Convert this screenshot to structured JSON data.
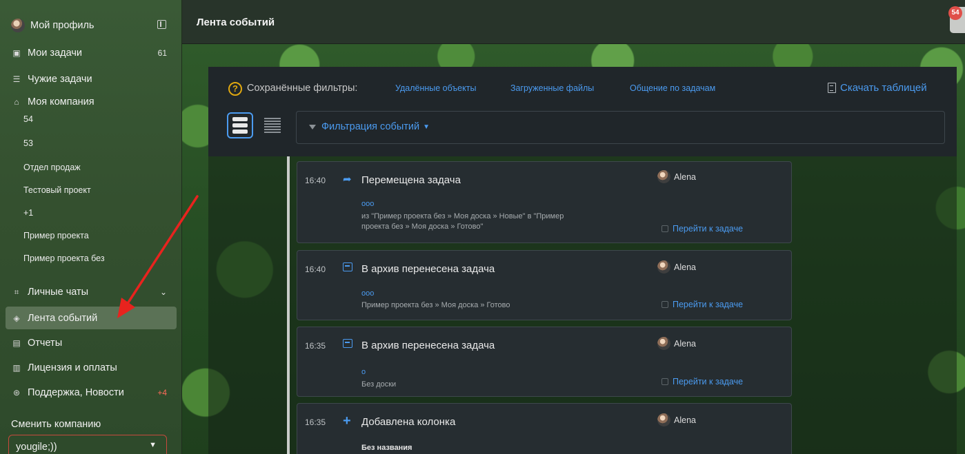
{
  "sidebar": {
    "profile": {
      "label": "Мой профиль",
      "icon": "avatar"
    },
    "items": [
      {
        "label": "Мои задачи",
        "icon": "tasks-icon",
        "count": "61"
      },
      {
        "label": "Чужие задачи",
        "icon": "list-icon",
        "count": ""
      },
      {
        "label": "Моя компания",
        "icon": "company-icon",
        "count": ""
      }
    ],
    "projects": [
      "54",
      "53",
      "Отдел продаж",
      "Тестовый проект",
      "+1",
      "Пример проекта",
      "Пример проекта без"
    ],
    "personal_chats": {
      "label": "Личные чаты",
      "icon": "chat-icon"
    },
    "events_feed": {
      "label": "Лента событий",
      "icon": "feed-icon"
    },
    "reports": {
      "label": "Отчеты",
      "icon": "reports-icon"
    },
    "license": {
      "label": "Лицензия и оплаты",
      "icon": "license-icon"
    },
    "support": {
      "label": "Поддержка, Новости",
      "icon": "support-icon",
      "count": "+4"
    },
    "switch_company_label": "Сменить компанию",
    "company_value": "yougile;))"
  },
  "header": {
    "title": "Лента событий",
    "notification_count": "54"
  },
  "filters": {
    "saved_label": "Сохранённые фильтры:",
    "links": [
      "Удалённые объекты",
      "Загруженные файлы",
      "Общение по задачам"
    ],
    "download_label": "Скачать таблицей",
    "filter_button": "Фильтрация событий"
  },
  "events": [
    {
      "time": "16:40",
      "icon": "move-icon",
      "title": "Перемещена задача",
      "user": "Alena",
      "task": "ооо",
      "detail_line1": "из \"Пример проекта без » Моя доска » Новые\" в \"Пример",
      "detail_line2": "проекта без » Моя доска » Готово\"",
      "link": "Перейти к задаче"
    },
    {
      "time": "16:40",
      "icon": "archive-icon",
      "title": "В архив перенесена задача",
      "user": "Alena",
      "task": "ооо",
      "detail_line1": "Пример проекта без » Моя доска » Готово",
      "link": "Перейти к задаче"
    },
    {
      "time": "16:35",
      "icon": "archive-icon",
      "title": "В архив перенесена задача",
      "user": "Alena",
      "task": "о",
      "detail_line1": "Без доски",
      "link": "Перейти к задаче"
    },
    {
      "time": "16:35",
      "icon": "plus-icon",
      "title": "Добавлена колонка",
      "user": "Alena",
      "detail_bold": "Без названия"
    }
  ],
  "colors": {
    "accent": "#4b9bf0",
    "annotation_arrow": "#e8231e",
    "sidebar_active": "#5b7256"
  }
}
